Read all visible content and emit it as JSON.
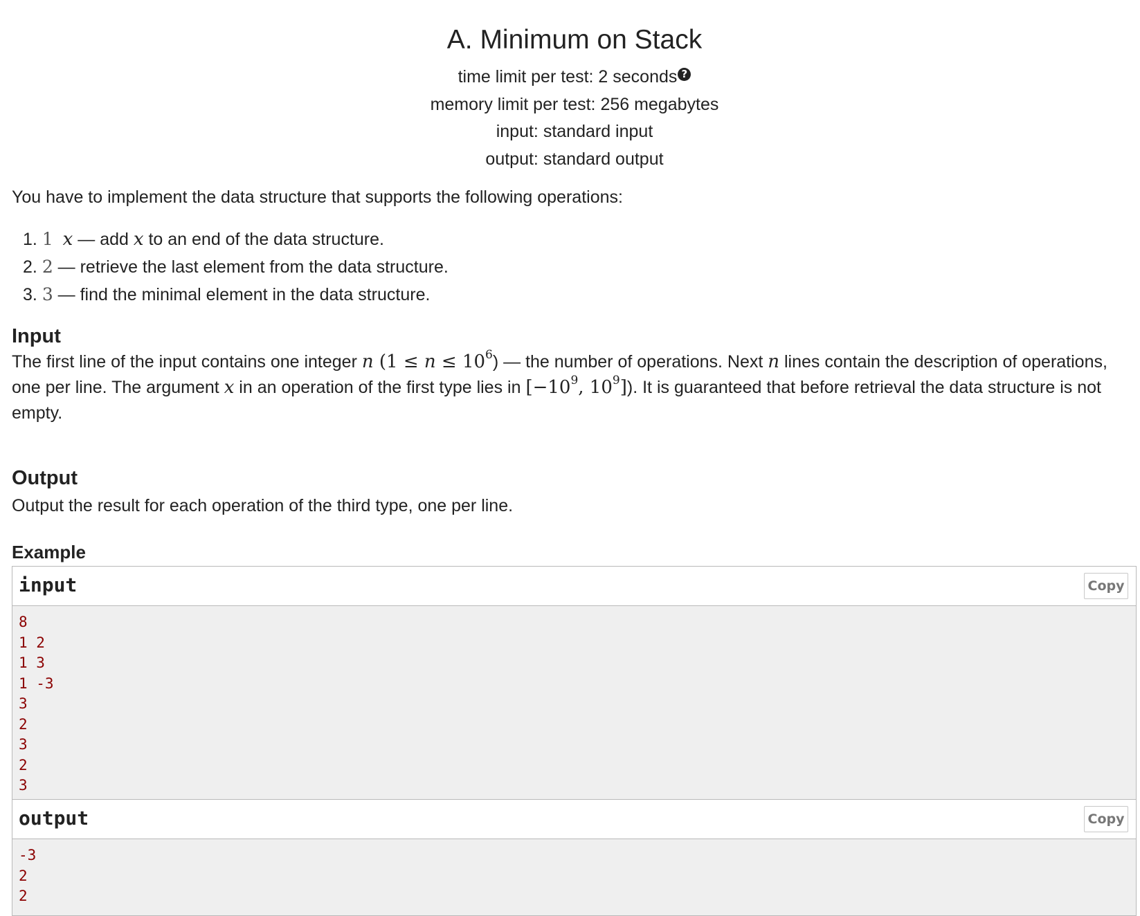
{
  "header": {
    "title": "A. Minimum on Stack",
    "time_limit": "time limit per test: 2 seconds",
    "memory_limit": "memory limit per test: 256 megabytes",
    "input_spec": "input: standard input",
    "output_spec": "output: standard output"
  },
  "statement": {
    "intro": "You have to implement the data structure that supports the following operations:",
    "operations": [
      {
        "num": "1.",
        "code": "1",
        "arg": "x",
        "text_a": " — add ",
        "var": "x",
        "text_b": " to an end of the data structure."
      },
      {
        "num": "2.",
        "code": "2",
        "text": " — retrieve the last element from the data structure."
      },
      {
        "num": "3.",
        "code": "3",
        "text": " — find the minimal element in the data structure."
      }
    ]
  },
  "input_section": {
    "title": "Input",
    "p1": "The first line of the input contains one integer ",
    "var_n": "n",
    "constraint_open": " (1 ≤ ",
    "constraint_close": " ≤ 10",
    "exp6": "6",
    "p2": ") — the number of operations. Next ",
    "p3": " lines contain the description of operations, one per line. The argument ",
    "var_x": "x",
    "p4": " in an operation of the first type lies in ",
    "range_open": "[−10",
    "exp9": "9",
    "range_mid": ", 10",
    "range_close": "]",
    "p5": "). It is guaranteed that before retrieval the data structure is not empty."
  },
  "output_section": {
    "title": "Output",
    "text": "Output the result for each operation of the third type, one per line."
  },
  "example": {
    "title": "Example",
    "input_label": "input",
    "output_label": "output",
    "copy_label": "Copy",
    "input_text": "8\n1 2\n1 3\n1 -3\n3\n2\n3\n2\n3",
    "output_text": "-3\n2\n2"
  }
}
